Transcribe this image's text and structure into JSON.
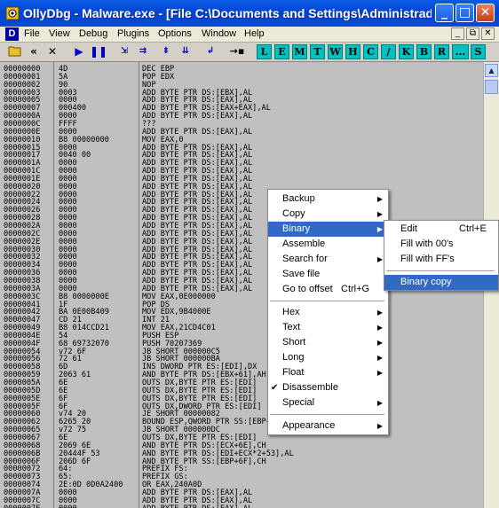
{
  "window": {
    "title": "OllyDbg - Malware.exe - [File C:\\Documents and Settings\\Administrador\\...",
    "minimize": "_",
    "maximize": "□",
    "close": "✕"
  },
  "menubar": {
    "mdi_icon": "D",
    "items": [
      "File",
      "View",
      "Debug",
      "Plugins",
      "Options",
      "Window",
      "Help"
    ],
    "mdi_buttons": [
      "_",
      "⧉",
      "✕"
    ]
  },
  "toolbar": {
    "buttons": [
      "open-icon",
      "restart-icon",
      "close-icon",
      "run-icon",
      "pause-icon",
      "step-into-icon",
      "step-over-icon",
      "trace-into-icon",
      "trace-over-icon",
      "execute-till-return-icon",
      "goto-icon"
    ],
    "letters": [
      "L",
      "E",
      "M",
      "T",
      "W",
      "H",
      "C",
      "/",
      "K",
      "B",
      "R",
      "...",
      "S"
    ]
  },
  "disasm": {
    "rows": [
      [
        "00000000",
        "4D",
        "DEC EBP"
      ],
      [
        "00000001",
        "5A",
        "POP EDX"
      ],
      [
        "00000002",
        "90",
        "NOP"
      ],
      [
        "00000003",
        "0003",
        "ADD BYTE PTR DS:[EBX],AL"
      ],
      [
        "00000005",
        "0000",
        "ADD BYTE PTR DS:[EAX],AL"
      ],
      [
        "00000007",
        "000400",
        "ADD BYTE PTR DS:[EAX+EAX],AL"
      ],
      [
        "0000000A",
        "0000",
        "ADD BYTE PTR DS:[EAX],AL"
      ],
      [
        "0000000C",
        "FFFF",
        "???"
      ],
      [
        "0000000E",
        "0000",
        "ADD BYTE PTR DS:[EAX],AL"
      ],
      [
        "00000010",
        "B8 00000000",
        "MOV EAX,0"
      ],
      [
        "00000015",
        "0000",
        "ADD BYTE PTR DS:[EAX],AL"
      ],
      [
        "00000017",
        "0040 00",
        "ADD BYTE PTR DS:[EAX],AL"
      ],
      [
        "0000001A",
        "0000",
        "ADD BYTE PTR DS:[EAX],AL"
      ],
      [
        "0000001C",
        "0000",
        "ADD BYTE PTR DS:[EAX],AL"
      ],
      [
        "0000001E",
        "0000",
        "ADD BYTE PTR DS:[EAX],AL"
      ],
      [
        "00000020",
        "0000",
        "ADD BYTE PTR DS:[EAX],AL"
      ],
      [
        "00000022",
        "0000",
        "ADD BYTE PTR DS:[EAX],AL"
      ],
      [
        "00000024",
        "0000",
        "ADD BYTE PTR DS:[EAX],AL"
      ],
      [
        "00000026",
        "0000",
        "ADD BYTE PTR DS:[EAX],AL"
      ],
      [
        "00000028",
        "0000",
        "ADD BYTE PTR DS:[EAX],AL"
      ],
      [
        "0000002A",
        "0000",
        "ADD BYTE PTR DS:[EAX],AL"
      ],
      [
        "0000002C",
        "0000",
        "ADD BYTE PTR DS:[EAX],AL"
      ],
      [
        "0000002E",
        "0000",
        "ADD BYTE PTR DS:[EAX],AL"
      ],
      [
        "00000030",
        "0000",
        "ADD BYTE PTR DS:[EAX],AL"
      ],
      [
        "00000032",
        "0000",
        "ADD BYTE PTR DS:[EAX],AL"
      ],
      [
        "00000034",
        "0000",
        "ADD BYTE PTR DS:[EAX],AL"
      ],
      [
        "00000036",
        "0000",
        "ADD BYTE PTR DS:[EAX],AL"
      ],
      [
        "00000038",
        "0000",
        "ADD BYTE PTR DS:[EAX],AL"
      ],
      [
        "0000003A",
        "0000",
        "ADD BYTE PTR DS:[EAX],AL"
      ],
      [
        "0000003C",
        "B8 0000000E",
        "MOV EAX,0E000000"
      ],
      [
        "00000041",
        "1F",
        "POP DS"
      ],
      [
        "00000042",
        "BA 0E00B409",
        "MOV EDX,9B4000E"
      ],
      [
        "00000047",
        "CD 21",
        "INT 21"
      ],
      [
        "00000049",
        "B8 014CCD21",
        "MOV EAX,21CD4C01"
      ],
      [
        "0000004E",
        "54",
        "PUSH ESP"
      ],
      [
        "0000004F",
        "68 69732070",
        "PUSH 70207369"
      ],
      [
        "00000054",
        "v72 6F",
        "JB SHORT 000000C5"
      ],
      [
        "00000056",
        "72 61",
        "JB SHORT 000000BA"
      ],
      [
        "00000058",
        "6D",
        "INS DWORD PTR ES:[EDI],DX"
      ],
      [
        "00000059",
        "2063 61",
        "AND BYTE PTR DS:[EBX+61],AH"
      ],
      [
        "0000005A",
        "6E",
        "OUTS DX,BYTE PTR ES:[EDI]"
      ],
      [
        "0000005D",
        "6E",
        "OUTS DX,BYTE PTR ES:[EDI]"
      ],
      [
        "0000005E",
        "6F",
        "OUTS DX,BYTE PTR ES:[EDI]"
      ],
      [
        "0000005F",
        "6F",
        "OUTS DX,DWORD PTR ES:[EDI]"
      ],
      [
        "00000060",
        "v74 20",
        "JE SHORT 00000082"
      ],
      [
        "00000062",
        "6265 20",
        "BOUND ESP,QWORD PTR SS:[EBP+20]"
      ],
      [
        "00000065",
        "v72 75",
        "JB SHORT 000000DC"
      ],
      [
        "00000067",
        "6E",
        "OUTS DX,BYTE PTR ES:[EDI]"
      ],
      [
        "00000068",
        "2069 6E",
        "AND BYTE PTR DS:[ECX+6E],CH"
      ],
      [
        "0000006B",
        "20444F 53",
        "AND BYTE PTR DS:[EDI+ECX*2+53],AL"
      ],
      [
        "0000006F",
        "206D 6F",
        "AND BYTE PTR SS:[EBP+6F],CH"
      ],
      [
        "00000072",
        "64:",
        "PREFIX FS:"
      ],
      [
        "00000073",
        "65:",
        "PREFIX GS:"
      ],
      [
        "00000074",
        "2E:0D 0D0A2400",
        "OR EAX,240A0D"
      ],
      [
        "0000007A",
        "0000",
        "ADD BYTE PTR DS:[EAX],AL"
      ],
      [
        "0000007C",
        "0000",
        "ADD BYTE PTR DS:[EAX],AL"
      ],
      [
        "0000007E",
        "0000",
        "ADD BYTE PTR DS:[EAX],AL"
      ]
    ]
  },
  "context_menu": {
    "items": [
      {
        "label": "Backup",
        "submenu": true
      },
      {
        "label": "Copy",
        "submenu": true
      },
      {
        "label": "Binary",
        "submenu": true,
        "highlighted": true
      },
      {
        "label": "Assemble"
      },
      {
        "label": "Search for",
        "submenu": true
      },
      {
        "label": "Save file"
      },
      {
        "label": "Go to offset",
        "shortcut": "Ctrl+G"
      },
      {
        "separator": true
      },
      {
        "label": "Hex",
        "submenu": true
      },
      {
        "label": "Text",
        "submenu": true
      },
      {
        "label": "Short",
        "submenu": true
      },
      {
        "label": "Long",
        "submenu": true
      },
      {
        "label": "Float",
        "submenu": true
      },
      {
        "label": "Disassemble",
        "checked": true
      },
      {
        "label": "Special",
        "submenu": true
      },
      {
        "separator": true
      },
      {
        "label": "Appearance",
        "submenu": true
      }
    ]
  },
  "binary_submenu": {
    "items": [
      {
        "label": "Edit",
        "shortcut": "Ctrl+E"
      },
      {
        "label": "Fill with 00's"
      },
      {
        "label": "Fill with FF's"
      },
      {
        "separator": true
      },
      {
        "label": "Binary copy",
        "highlighted": true
      }
    ]
  },
  "colors": {
    "title_bar": "#0a5ce6",
    "highlight": "#316ac5",
    "disasm_bg": "#c0c0c0",
    "letter_button": "#00c0c0"
  }
}
